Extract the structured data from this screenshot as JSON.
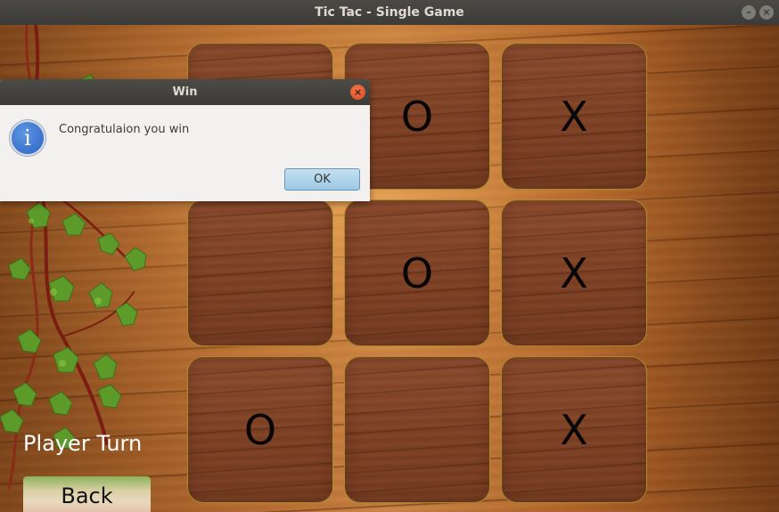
{
  "window": {
    "title": "Tic Tac - Single Game",
    "minimize_glyph": "–",
    "close_glyph": "×"
  },
  "board": {
    "cells": [
      "",
      "O",
      "X",
      "",
      "O",
      "X",
      "O",
      "",
      "X"
    ]
  },
  "player_turn_label": "Player Turn",
  "back_button_label": "Back",
  "dialog": {
    "title": "Win",
    "icon": "info-icon",
    "icon_glyph": "i",
    "message": "Congratulaion you win",
    "ok_label": "OK",
    "close_glyph": "×"
  },
  "colors": {
    "mark": "#080606",
    "cell_border": "#a98b2c",
    "ok_button": "#9ec8e4"
  }
}
